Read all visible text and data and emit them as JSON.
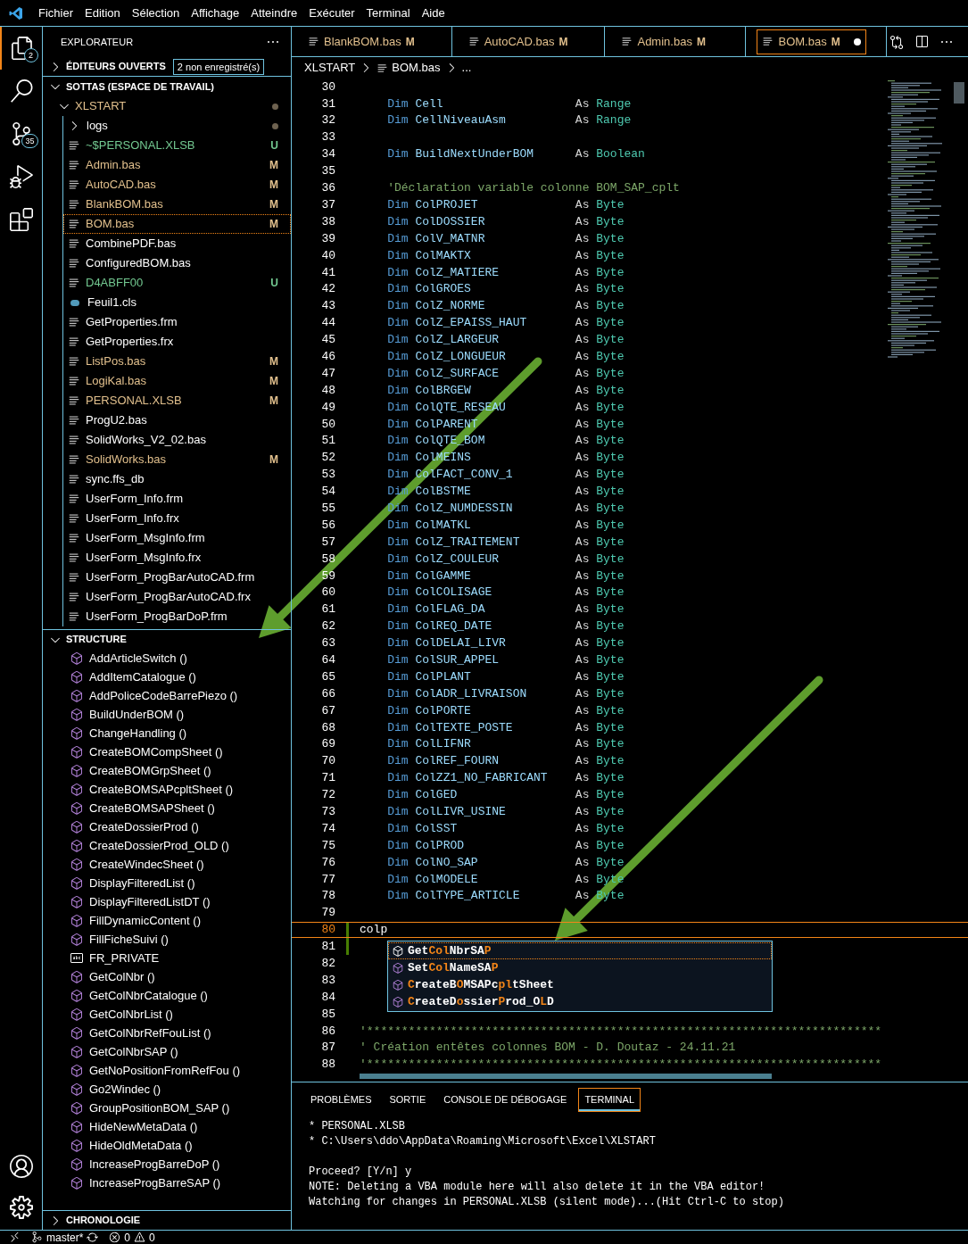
{
  "menu": [
    "Fichier",
    "Edition",
    "Sélection",
    "Affichage",
    "Atteindre",
    "Exécuter",
    "Terminal",
    "Aide"
  ],
  "activity": [
    {
      "kind": "explorer",
      "badge": "2",
      "selected": true
    },
    {
      "kind": "search",
      "selected": false
    },
    {
      "kind": "scm",
      "badge": "35",
      "selected": false
    },
    {
      "kind": "debug",
      "selected": false
    },
    {
      "kind": "extensions",
      "selected": false
    }
  ],
  "activity_bottom": [
    {
      "kind": "account"
    },
    {
      "kind": "settings"
    }
  ],
  "sidebar": {
    "title": "EXPLORATEUR",
    "open_editors": {
      "label": "ÉDITEURS OUVERTS",
      "badge": "2 non enregistré(s)",
      "expanded": false
    },
    "workspace": {
      "label": "SOTTAS (ESPACE DE TRAVAIL)",
      "expanded": true
    },
    "folder": {
      "label": "XLSTART",
      "expanded": true
    },
    "files": [
      {
        "name": "logs",
        "kind": "folder",
        "color": "#ffffff",
        "selected": false
      },
      {
        "name": "~$PERSONAL.XLSB",
        "kind": "file",
        "color": "#73c991",
        "badge": "U",
        "selected": false
      },
      {
        "name": "Admin.bas",
        "kind": "file",
        "color": "#e2c08d",
        "badge": "M",
        "selected": false
      },
      {
        "name": "AutoCAD.bas",
        "kind": "file",
        "color": "#e2c08d",
        "badge": "M",
        "selected": false
      },
      {
        "name": "BlankBOM.bas",
        "kind": "file",
        "color": "#e2c08d",
        "badge": "M",
        "selected": false
      },
      {
        "name": "BOM.bas",
        "kind": "file",
        "color": "#e2c08d",
        "badge": "M",
        "selected": true
      },
      {
        "name": "CombinePDF.bas",
        "kind": "file",
        "color": "#ffffff",
        "selected": false
      },
      {
        "name": "ConfiguredBOM.bas",
        "kind": "file",
        "color": "#ffffff",
        "selected": false
      },
      {
        "name": "D4ABFF00",
        "kind": "file",
        "color": "#73c991",
        "badge": "U",
        "selected": false
      },
      {
        "name": "Feuil1.cls",
        "kind": "class",
        "color": "#ffffff",
        "selected": false
      },
      {
        "name": "GetProperties.frm",
        "kind": "file",
        "color": "#ffffff",
        "selected": false
      },
      {
        "name": "GetProperties.frx",
        "kind": "file",
        "color": "#ffffff",
        "selected": false
      },
      {
        "name": "ListPos.bas",
        "kind": "file",
        "color": "#e2c08d",
        "badge": "M",
        "selected": false
      },
      {
        "name": "LogiKal.bas",
        "kind": "file",
        "color": "#e2c08d",
        "badge": "M",
        "selected": false
      },
      {
        "name": "PERSONAL.XLSB",
        "kind": "file",
        "color": "#e2c08d",
        "badge": "M",
        "selected": false
      },
      {
        "name": "ProgU2.bas",
        "kind": "file",
        "color": "#ffffff",
        "selected": false
      },
      {
        "name": "SolidWorks_V2_02.bas",
        "kind": "file",
        "color": "#ffffff",
        "selected": false
      },
      {
        "name": "SolidWorks.bas",
        "kind": "file",
        "color": "#e2c08d",
        "badge": "M",
        "selected": false
      },
      {
        "name": "sync.ffs_db",
        "kind": "file",
        "color": "#ffffff",
        "selected": false
      },
      {
        "name": "UserForm_Info.frm",
        "kind": "file",
        "color": "#ffffff",
        "selected": false
      },
      {
        "name": "UserForm_Info.frx",
        "kind": "file",
        "color": "#ffffff",
        "selected": false
      },
      {
        "name": "UserForm_MsgInfo.frm",
        "kind": "file",
        "color": "#ffffff",
        "selected": false
      },
      {
        "name": "UserForm_MsgInfo.frx",
        "kind": "file",
        "color": "#ffffff",
        "selected": false
      },
      {
        "name": "UserForm_ProgBarAutoCAD.frm",
        "kind": "file",
        "color": "#ffffff",
        "selected": false
      },
      {
        "name": "UserForm_ProgBarAutoCAD.frx",
        "kind": "file",
        "color": "#ffffff",
        "selected": false
      },
      {
        "name": "UserForm_ProgBarDoP.frm",
        "kind": "file",
        "color": "#ffffff",
        "selected": false
      }
    ],
    "structure": {
      "label": "STRUCTURE",
      "expanded": true,
      "items": [
        {
          "name": "AddArticleSwitch ()",
          "kind": "method"
        },
        {
          "name": "AddItemCatalogue ()",
          "kind": "method"
        },
        {
          "name": "AddPoliceCodeBarrePiezo ()",
          "kind": "method"
        },
        {
          "name": "BuildUnderBOM ()",
          "kind": "method"
        },
        {
          "name": "ChangeHandling ()",
          "kind": "method"
        },
        {
          "name": "CreateBOMCompSheet ()",
          "kind": "method"
        },
        {
          "name": "CreateBOMGrpSheet ()",
          "kind": "method"
        },
        {
          "name": "CreateBOMSAPcpltSheet ()",
          "kind": "method"
        },
        {
          "name": "CreateBOMSAPSheet ()",
          "kind": "method"
        },
        {
          "name": "CreateDossierProd ()",
          "kind": "method"
        },
        {
          "name": "CreateDossierProd_OLD ()",
          "kind": "method"
        },
        {
          "name": "CreateWindecSheet ()",
          "kind": "method"
        },
        {
          "name": "DisplayFilteredList ()",
          "kind": "method"
        },
        {
          "name": "DisplayFilteredListDT ()",
          "kind": "method"
        },
        {
          "name": "FillDynamicContent ()",
          "kind": "method"
        },
        {
          "name": "FillFicheSuivi ()",
          "kind": "method"
        },
        {
          "name": "FR_PRIVATE",
          "kind": "field"
        },
        {
          "name": "GetColNbr ()",
          "kind": "method"
        },
        {
          "name": "GetColNbrCatalogue ()",
          "kind": "method"
        },
        {
          "name": "GetColNbrList ()",
          "kind": "method"
        },
        {
          "name": "GetColNbrRefFouList ()",
          "kind": "method"
        },
        {
          "name": "GetColNbrSAP ()",
          "kind": "method"
        },
        {
          "name": "GetNoPositionFromRefFou ()",
          "kind": "method"
        },
        {
          "name": "Go2Windec ()",
          "kind": "method"
        },
        {
          "name": "GroupPositionBOM_SAP ()",
          "kind": "method"
        },
        {
          "name": "HideNewMetaData ()",
          "kind": "method"
        },
        {
          "name": "HideOldMetaData ()",
          "kind": "method"
        },
        {
          "name": "IncreaseProgBarreDoP ()",
          "kind": "method"
        },
        {
          "name": "IncreaseProgBarreSAP ()",
          "kind": "method"
        }
      ]
    },
    "timeline": {
      "label": "CHRONOLOGIE",
      "expanded": false
    }
  },
  "tabs": [
    {
      "label": "BlankBOM.bas",
      "badge": "M",
      "selected": false,
      "dirty": false
    },
    {
      "label": "AutoCAD.bas",
      "badge": "M",
      "selected": false,
      "dirty": false
    },
    {
      "label": "Admin.bas",
      "badge": "M",
      "selected": false,
      "dirty": false
    },
    {
      "label": "BOM.bas",
      "badge": "M",
      "selected": true,
      "dirty": true
    }
  ],
  "breadcrumb": [
    "XLSTART",
    "BOM.bas",
    "..."
  ],
  "code": [
    {
      "n": "30",
      "kind": "blank",
      "changed": false,
      "current": false
    },
    {
      "n": "31",
      "kind": "dim",
      "kw": "Dim",
      "name": "Cell",
      "as": "As",
      "type": "Range",
      "changed": false,
      "current": false
    },
    {
      "n": "32",
      "kind": "dim",
      "kw": "Dim",
      "name": "CellNiveauAsm",
      "as": "As",
      "type": "Range",
      "changed": false,
      "current": false
    },
    {
      "n": "33",
      "kind": "blank",
      "changed": false,
      "current": false
    },
    {
      "n": "34",
      "kind": "dim",
      "kw": "Dim",
      "name": "BuildNextUnderBOM",
      "as": "As",
      "type": "Boolean",
      "changed": false,
      "current": false
    },
    {
      "n": "35",
      "kind": "blank",
      "changed": false,
      "current": false
    },
    {
      "n": "36",
      "kind": "comment",
      "indent": true,
      "text": "'Déclaration variable colonne BOM_SAP_cplt",
      "changed": false,
      "current": false
    },
    {
      "n": "37",
      "kind": "dim",
      "kw": "Dim",
      "name": "ColPROJET",
      "as": "As",
      "type": "Byte",
      "changed": false,
      "current": false
    },
    {
      "n": "38",
      "kind": "dim",
      "kw": "Dim",
      "name": "ColDOSSIER",
      "as": "As",
      "type": "Byte",
      "changed": false,
      "current": false
    },
    {
      "n": "39",
      "kind": "dim",
      "kw": "Dim",
      "name": "ColV_MATNR",
      "as": "As",
      "type": "Byte",
      "changed": false,
      "current": false
    },
    {
      "n": "40",
      "kind": "dim",
      "kw": "Dim",
      "name": "ColMAKTX",
      "as": "As",
      "type": "Byte",
      "changed": false,
      "current": false
    },
    {
      "n": "41",
      "kind": "dim",
      "kw": "Dim",
      "name": "ColZ_MATIERE",
      "as": "As",
      "type": "Byte",
      "changed": false,
      "current": false
    },
    {
      "n": "42",
      "kind": "dim",
      "kw": "Dim",
      "name": "ColGROES",
      "as": "As",
      "type": "Byte",
      "changed": false,
      "current": false
    },
    {
      "n": "43",
      "kind": "dim",
      "kw": "Dim",
      "name": "ColZ_NORME",
      "as": "As",
      "type": "Byte",
      "changed": false,
      "current": false
    },
    {
      "n": "44",
      "kind": "dim",
      "kw": "Dim",
      "name": "ColZ_EPAISS_HAUT",
      "as": "As",
      "type": "Byte",
      "changed": false,
      "current": false
    },
    {
      "n": "45",
      "kind": "dim",
      "kw": "Dim",
      "name": "ColZ_LARGEUR",
      "as": "As",
      "type": "Byte",
      "changed": false,
      "current": false
    },
    {
      "n": "46",
      "kind": "dim",
      "kw": "Dim",
      "name": "ColZ_LONGUEUR",
      "as": "As",
      "type": "Byte",
      "changed": false,
      "current": false
    },
    {
      "n": "47",
      "kind": "dim",
      "kw": "Dim",
      "name": "ColZ_SURFACE",
      "as": "As",
      "type": "Byte",
      "changed": false,
      "current": false
    },
    {
      "n": "48",
      "kind": "dim",
      "kw": "Dim",
      "name": "ColBRGEW",
      "as": "As",
      "type": "Byte",
      "changed": false,
      "current": false
    },
    {
      "n": "49",
      "kind": "dim",
      "kw": "Dim",
      "name": "ColQTE_RESEAU",
      "as": "As",
      "type": "Byte",
      "changed": false,
      "current": false
    },
    {
      "n": "50",
      "kind": "dim",
      "kw": "Dim",
      "name": "ColPARENT",
      "as": "As",
      "type": "Byte",
      "changed": false,
      "current": false
    },
    {
      "n": "51",
      "kind": "dim",
      "kw": "Dim",
      "name": "ColQTE_BOM",
      "as": "As",
      "type": "Byte",
      "changed": false,
      "current": false
    },
    {
      "n": "52",
      "kind": "dim",
      "kw": "Dim",
      "name": "ColMEINS",
      "as": "As",
      "type": "Byte",
      "changed": false,
      "current": false
    },
    {
      "n": "53",
      "kind": "dim",
      "kw": "Dim",
      "name": "ColFACT_CONV_1",
      "as": "As",
      "type": "Byte",
      "changed": false,
      "current": false
    },
    {
      "n": "54",
      "kind": "dim",
      "kw": "Dim",
      "name": "ColBSTME",
      "as": "As",
      "type": "Byte",
      "changed": false,
      "current": false
    },
    {
      "n": "55",
      "kind": "dim",
      "kw": "Dim",
      "name": "ColZ_NUMDESSIN",
      "as": "As",
      "type": "Byte",
      "changed": false,
      "current": false
    },
    {
      "n": "56",
      "kind": "dim",
      "kw": "Dim",
      "name": "ColMATKL",
      "as": "As",
      "type": "Byte",
      "changed": false,
      "current": false
    },
    {
      "n": "57",
      "kind": "dim",
      "kw": "Dim",
      "name": "ColZ_TRAITEMENT",
      "as": "As",
      "type": "Byte",
      "changed": false,
      "current": false
    },
    {
      "n": "58",
      "kind": "dim",
      "kw": "Dim",
      "name": "ColZ_COULEUR",
      "as": "As",
      "type": "Byte",
      "changed": false,
      "current": false
    },
    {
      "n": "59",
      "kind": "dim",
      "kw": "Dim",
      "name": "ColGAMME",
      "as": "As",
      "type": "Byte",
      "changed": false,
      "current": false
    },
    {
      "n": "60",
      "kind": "dim",
      "kw": "Dim",
      "name": "ColCOLISAGE",
      "as": "As",
      "type": "Byte",
      "changed": false,
      "current": false
    },
    {
      "n": "61",
      "kind": "dim",
      "kw": "Dim",
      "name": "ColFLAG_DA",
      "as": "As",
      "type": "Byte",
      "changed": false,
      "current": false
    },
    {
      "n": "62",
      "kind": "dim",
      "kw": "Dim",
      "name": "ColREQ_DATE",
      "as": "As",
      "type": "Byte",
      "changed": false,
      "current": false
    },
    {
      "n": "63",
      "kind": "dim",
      "kw": "Dim",
      "name": "ColDELAI_LIVR",
      "as": "As",
      "type": "Byte",
      "changed": false,
      "current": false
    },
    {
      "n": "64",
      "kind": "dim",
      "kw": "Dim",
      "name": "ColSUR_APPEL",
      "as": "As",
      "type": "Byte",
      "changed": false,
      "current": false
    },
    {
      "n": "65",
      "kind": "dim",
      "kw": "Dim",
      "name": "ColPLANT",
      "as": "As",
      "type": "Byte",
      "changed": false,
      "current": false
    },
    {
      "n": "66",
      "kind": "dim",
      "kw": "Dim",
      "name": "ColADR_LIVRAISON",
      "as": "As",
      "type": "Byte",
      "changed": false,
      "current": false
    },
    {
      "n": "67",
      "kind": "dim",
      "kw": "Dim",
      "name": "ColPORTE",
      "as": "As",
      "type": "Byte",
      "changed": false,
      "current": false
    },
    {
      "n": "68",
      "kind": "dim",
      "kw": "Dim",
      "name": "ColTEXTE_POSTE",
      "as": "As",
      "type": "Byte",
      "changed": false,
      "current": false
    },
    {
      "n": "69",
      "kind": "dim",
      "kw": "Dim",
      "name": "ColLIFNR",
      "as": "As",
      "type": "Byte",
      "changed": false,
      "current": false
    },
    {
      "n": "70",
      "kind": "dim",
      "kw": "Dim",
      "name": "ColREF_FOURN",
      "as": "As",
      "type": "Byte",
      "changed": false,
      "current": false
    },
    {
      "n": "71",
      "kind": "dim",
      "kw": "Dim",
      "name": "ColZZ1_NO_FABRICANT",
      "as": "As",
      "type": "Byte",
      "changed": false,
      "current": false
    },
    {
      "n": "72",
      "kind": "dim",
      "kw": "Dim",
      "name": "ColGED",
      "as": "As",
      "type": "Byte",
      "changed": false,
      "current": false
    },
    {
      "n": "73",
      "kind": "dim",
      "kw": "Dim",
      "name": "ColLIVR_USINE",
      "as": "As",
      "type": "Byte",
      "changed": false,
      "current": false
    },
    {
      "n": "74",
      "kind": "dim",
      "kw": "Dim",
      "name": "ColSST",
      "as": "As",
      "type": "Byte",
      "changed": false,
      "current": false
    },
    {
      "n": "75",
      "kind": "dim",
      "kw": "Dim",
      "name": "ColPROD",
      "as": "As",
      "type": "Byte",
      "changed": false,
      "current": false
    },
    {
      "n": "76",
      "kind": "dim",
      "kw": "Dim",
      "name": "ColNO_SAP",
      "as": "As",
      "type": "Byte",
      "changed": false,
      "current": false
    },
    {
      "n": "77",
      "kind": "dim",
      "kw": "Dim",
      "name": "ColMODELE",
      "as": "As",
      "type": "Byte",
      "changed": false,
      "current": false
    },
    {
      "n": "78",
      "kind": "dim",
      "kw": "Dim",
      "name": "ColTYPE_ARTICLE",
      "as": "As",
      "type": "Byte",
      "changed": false,
      "current": false
    },
    {
      "n": "79",
      "kind": "blank",
      "changed": false,
      "current": false
    },
    {
      "n": "80",
      "kind": "plain",
      "text": "colp",
      "changed": true,
      "current": true
    },
    {
      "n": "81",
      "kind": "blank",
      "changed": true,
      "current": false
    },
    {
      "n": "82",
      "kind": "blank",
      "changed": false,
      "current": false
    },
    {
      "n": "83",
      "kind": "blank",
      "changed": false,
      "current": false
    },
    {
      "n": "84",
      "kind": "blank",
      "changed": false,
      "current": false
    },
    {
      "n": "85",
      "kind": "blank",
      "changed": false,
      "current": false
    },
    {
      "n": "86",
      "kind": "comment",
      "indent": false,
      "text": "'**************************************************************************",
      "changed": false,
      "current": false
    },
    {
      "n": "87",
      "kind": "comment",
      "indent": false,
      "text": "' Création entêtes colonnes BOM - D. Doutaz - 24.11.21",
      "changed": false,
      "current": false
    },
    {
      "n": "88",
      "kind": "comment",
      "indent": false,
      "text": "'**************************************************************************",
      "changed": false,
      "current": false
    }
  ],
  "suggestions": [
    {
      "selected": true,
      "segments": [
        {
          "text": "Get",
          "match": false
        },
        {
          "text": "Col",
          "match": true
        },
        {
          "text": "NbrSA",
          "match": false
        },
        {
          "text": "P",
          "match": true
        }
      ]
    },
    {
      "selected": false,
      "segments": [
        {
          "text": "Set",
          "match": false
        },
        {
          "text": "Col",
          "match": true
        },
        {
          "text": "NameSA",
          "match": false
        },
        {
          "text": "P",
          "match": true
        }
      ]
    },
    {
      "selected": false,
      "segments": [
        {
          "text": "C",
          "match": true
        },
        {
          "text": "reateB",
          "match": false
        },
        {
          "text": "O",
          "match": true
        },
        {
          "text": "MSAPc",
          "match": false
        },
        {
          "text": "pl",
          "match": true
        },
        {
          "text": "tSheet",
          "match": false
        }
      ]
    },
    {
      "selected": false,
      "segments": [
        {
          "text": "C",
          "match": true
        },
        {
          "text": "reateD",
          "match": false
        },
        {
          "text": "o",
          "match": true
        },
        {
          "text": "ssier",
          "match": false
        },
        {
          "text": "P",
          "match": true
        },
        {
          "text": "rod_O",
          "match": false
        },
        {
          "text": "L",
          "match": true
        },
        {
          "text": "D",
          "match": false
        }
      ]
    }
  ],
  "panel": {
    "tabs": [
      {
        "label": "PROBLÈMES",
        "selected": false
      },
      {
        "label": "SORTIE",
        "selected": false
      },
      {
        "label": "CONSOLE DE DÉBOGAGE",
        "selected": false
      },
      {
        "label": "TERMINAL",
        "selected": true
      }
    ],
    "terminal": [
      [
        "* PERSONAL.XLSB",
        "* C:\\Users\\ddo\\AppData\\Roaming\\Microsoft\\Excel\\XLSTART"
      ],
      [
        "Proceed? [Y/n] y",
        "NOTE: Deleting a VBA module here will also delete it in the VBA editor!",
        "Watching for changes in PERSONAL.XLSB (silent mode)...(Hit Ctrl-C to stop)"
      ]
    ]
  },
  "status_bar": {
    "branch": "master*",
    "errors": "0",
    "warnings": "0"
  }
}
